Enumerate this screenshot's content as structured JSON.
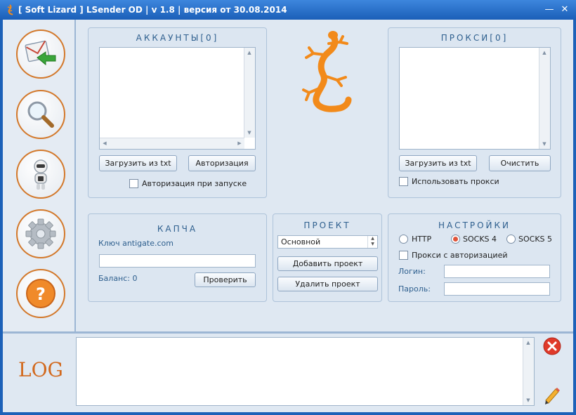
{
  "window": {
    "title": "[ Soft Lizard ] LSender OD  |  v 1.8  |  версия от 30.08.2014",
    "minimize_glyph": "—",
    "close_glyph": "✕"
  },
  "sidebar": {
    "items": [
      {
        "icon": "mail-send-icon"
      },
      {
        "icon": "magnifier-icon"
      },
      {
        "icon": "robot-icon"
      },
      {
        "icon": "gear-icon"
      },
      {
        "icon": "help-icon",
        "glyph": "?"
      }
    ]
  },
  "accounts": {
    "title": "АККАУНТЫ[0]",
    "load_button": "Загрузить из txt",
    "auth_button": "Авторизация",
    "auth_on_start_label": "Авторизация при запуске",
    "auth_on_start_checked": false
  },
  "proxies": {
    "title": "ПРОКСИ[0]",
    "load_button": "Загрузить из txt",
    "clear_button": "Очистить",
    "use_proxy_label": "Использовать прокси",
    "use_proxy_checked": false
  },
  "captcha": {
    "title": "КАПЧА",
    "key_label": "Ключ antigate.com",
    "key_value": "",
    "balance_label": "Баланс: 0",
    "check_button": "Проверить"
  },
  "project": {
    "title": "ПРОЕКТ",
    "selected": "Основной",
    "add_button": "Добавить проект",
    "delete_button": "Удалить проект"
  },
  "settings": {
    "title": "НАСТРОЙКИ",
    "proxy_types": [
      "HTTP",
      "SOCKS 4",
      "SOCKS 5"
    ],
    "selected_proxy_type": "SOCKS 4",
    "auth_proxy_label": "Прокси с авторизацией",
    "auth_proxy_checked": false,
    "login_label": "Логин:",
    "login_value": "",
    "password_label": "Пароль:",
    "password_value": ""
  },
  "log": {
    "label": "LOG",
    "content": ""
  },
  "colors": {
    "accent_orange": "#d2691e",
    "panel_title_blue": "#2e5f8e",
    "titlebar_blue": "#1b5fb8"
  }
}
